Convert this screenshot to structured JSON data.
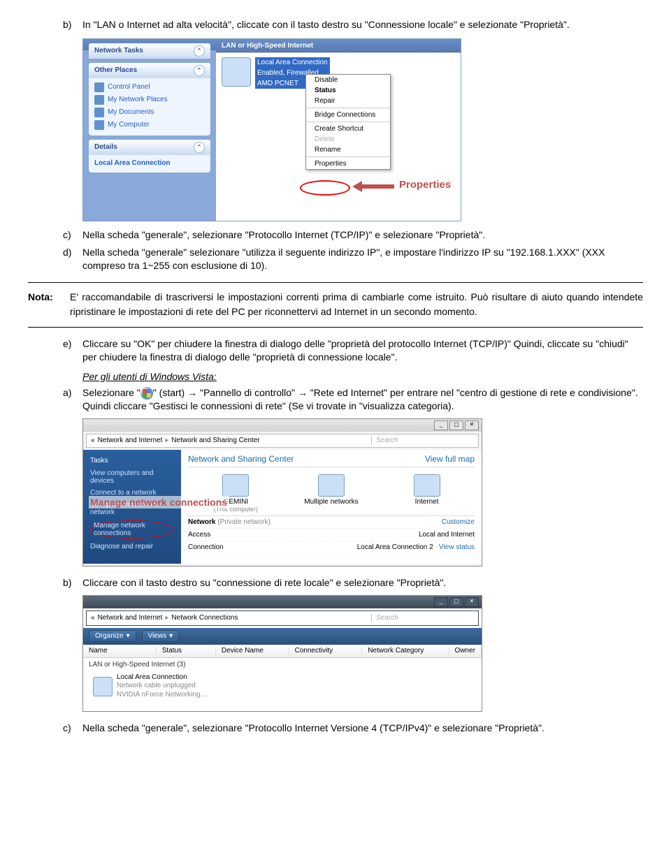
{
  "items": {
    "b": {
      "letter": "b)",
      "text": "In \"LAN o Internet ad alta velocità\", cliccate con il tasto destro su \"Connessione locale\" e selezionate \"Proprietà\"."
    },
    "c": {
      "letter": "c)",
      "text": "Nella scheda \"generale\", selezionare \"Protocollo Internet (TCP/IP)\" e selezionare \"Proprietà\"."
    },
    "d": {
      "letter": "d)",
      "text": "Nella scheda \"generale\" selezionare \"utilizza il seguente indirizzo IP\", e impostare l'indirizzo IP su \"192.168.1.XXX\" (XXX compreso tra 1~255 con esclusione di 10)."
    },
    "e": {
      "letter": "e)",
      "text": "Cliccare su \"OK\" per chiudere la finestra di dialogo delle \"proprietà del protocollo Internet (TCP/IP)\" Quindi, cliccate su \"chiudi\" per chiudere la finestra di dialogo delle \"proprietà di connessione locale\"."
    },
    "vista_a": {
      "letter": "a)",
      "pre": "Selezionare \"",
      "post": "\" (start) → \"Pannello di controllo\" → \"Rete ed Internet\" per entrare nel \"centro di gestione di rete e condivisione\". Quindi cliccare \"Gestisci le connessioni di rete\" (Se vi trovate in \"visualizza categoria)."
    },
    "b2": {
      "letter": "b)",
      "text": "Cliccare con il tasto destro su \"connessione di rete locale\" e selezionare \"Proprietà\"."
    },
    "c2": {
      "letter": "c)",
      "text": "Nella scheda \"generale\", selezionare \"Protocollo Internet Versione 4 (TCP/IPv4)\" e selezionare \"Proprietà\"."
    }
  },
  "nota": {
    "label": "Nota:",
    "text": "E' raccomandabile di trascriversi le impostazioni correnti prima di cambiarle come istruito. Può risultare di aiuto quando intendete ripristinare le impostazioni di rete del PC per riconnettervi ad Internet in un secondo momento."
  },
  "vista_heading": "Per gli utenti di Windows Vista:",
  "ss1": {
    "cat": "LAN or High-Speed Internet",
    "netTasks": "Network Tasks",
    "otherPlaces": "Other Places",
    "cp": "Control Panel",
    "mnp": "My Network Places",
    "md": "My Documents",
    "mc": "My Computer",
    "details": "Details",
    "lac": "Local Area Connection",
    "connTitle": "Local Area Connection",
    "connStatus": "Enabled, Firewalled",
    "connDev": "AMD PCNET",
    "menu": {
      "disable": "Disable",
      "status": "Status",
      "repair": "Repair",
      "bridge": "Bridge Connections",
      "shortcut": "Create Shortcut",
      "delete": "Delete",
      "rename": "Rename",
      "properties": "Properties"
    },
    "propsLabel": "Properties"
  },
  "ss2": {
    "bcBack": "«",
    "bc1": "Network and Internet",
    "bc2": "Network and Sharing Center",
    "searchHint": "Search",
    "tasks": "Tasks",
    "t1": "View computers and devices",
    "t2": "Connect to a network",
    "t3": "Set up a connection or network",
    "t4": "Manage network connections",
    "t5": "Diagnose and repair",
    "mncLabel": "Manage network connections",
    "title": "Network and Sharing Center",
    "viewMap": "View full map",
    "n1": "GEMINI",
    "n1sub": "(This computer)",
    "n2": "Multiple networks",
    "n3": "Internet",
    "r1a": "Network",
    "r1b": "(Private network)",
    "r1c": "Customize",
    "r2a": "Access",
    "r2b": "Local and Internet",
    "r3a": "Connection",
    "r3b": "Local Area Connection 2",
    "r3c": "View status"
  },
  "ss3": {
    "bc1": "Network and Internet",
    "bc2": "Network Connections",
    "organize": "Organize",
    "views": "Views",
    "cols": {
      "name": "Name",
      "status": "Status",
      "dev": "Device Name",
      "conn": "Connectivity",
      "cat": "Network Category",
      "owner": "Owner"
    },
    "cat": "LAN or High-Speed Internet (3)",
    "itemTitle": "Local Area Connection",
    "itemL1": "Network cable unplugged",
    "itemL2": "NVIDIA nForce Networking..."
  }
}
